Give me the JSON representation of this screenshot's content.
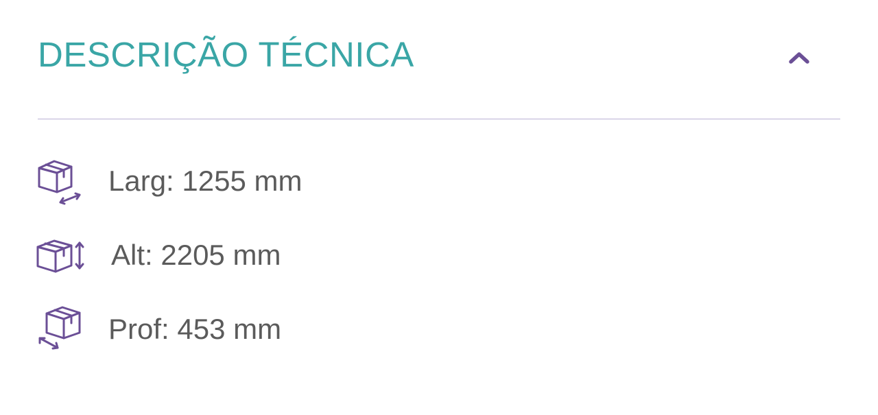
{
  "section": {
    "title": "DESCRIÇÃO TÉCNICA",
    "toggle_icon": "chevron-up-icon",
    "accent_color": "#3aa6a6",
    "icon_color": "#6b4f96"
  },
  "specs": [
    {
      "icon": "box-width-icon",
      "label": "Larg: 1255 mm"
    },
    {
      "icon": "box-height-icon",
      "label": "Alt: 2205 mm"
    },
    {
      "icon": "box-depth-icon",
      "label": "Prof: 453 mm"
    }
  ]
}
